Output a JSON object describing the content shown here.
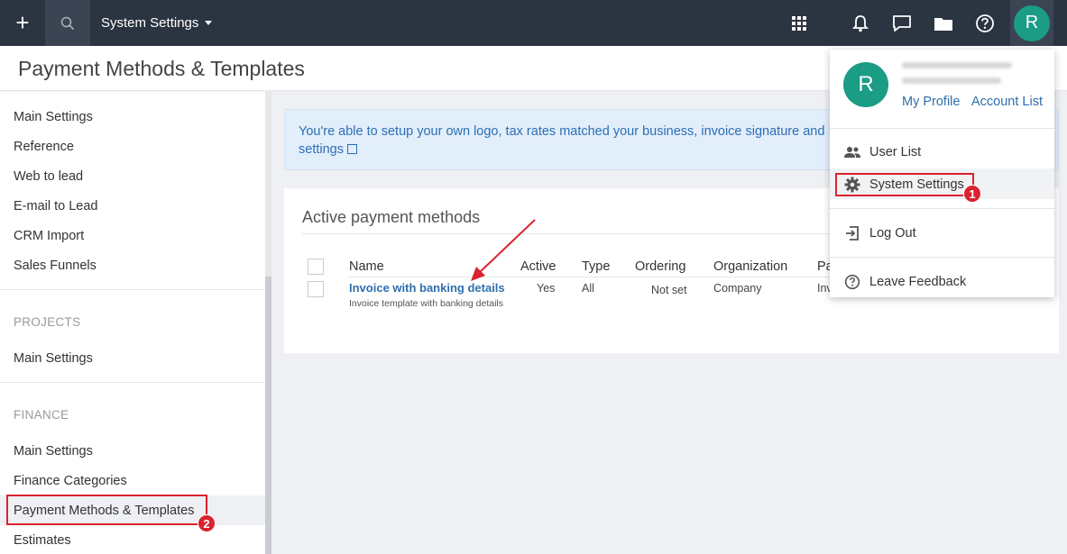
{
  "topbar": {
    "plus_label": "+",
    "menu_label": "System Settings",
    "avatar_initial": "R",
    "icons": [
      "apps-grid-icon",
      "bell-icon",
      "chat-icon",
      "folder-icon",
      "help-icon"
    ]
  },
  "page": {
    "title": "Payment Methods & Templates"
  },
  "sidebar": {
    "group1": [
      "Main Settings",
      "Reference",
      "Web to lead",
      "E-mail to Lead",
      "CRM Import",
      "Sales Funnels"
    ],
    "projects_header": "PROJECTS",
    "projects_items": [
      "Main Settings"
    ],
    "finance_header": "FINANCE",
    "finance_items": [
      "Main Settings",
      "Finance Categories",
      "Payment Methods & Templates",
      "Estimates"
    ]
  },
  "info": {
    "text": "You're able to setup your own logo, tax rates matched your business, invoice signature and",
    "link": "settings"
  },
  "card": {
    "title": "Active payment methods",
    "columns": [
      "Name",
      "Active",
      "Type",
      "Ordering",
      "Organization",
      "Pa"
    ],
    "row": {
      "name": "Invoice with banking details",
      "description": "Invoice template with banking details",
      "active": "Yes",
      "type": "All",
      "ordering": "Not set",
      "organization": "Company",
      "payment": "Inv"
    }
  },
  "dropdown": {
    "avatar_initial": "R",
    "my_profile": "My Profile",
    "account_list": "Account List",
    "user_list": "User List",
    "system_settings": "System Settings",
    "log_out": "Log Out",
    "leave_feedback": "Leave Feedback"
  },
  "annotations": {
    "badge1": "1",
    "badge2": "2",
    "highlight_color": "#d9232e"
  }
}
